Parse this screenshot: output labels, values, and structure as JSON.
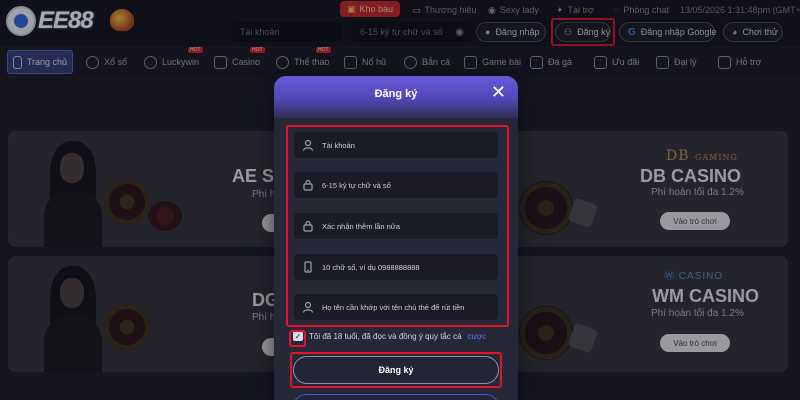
{
  "header": {
    "logo_text": "EE88",
    "links": [
      {
        "label": "Kho báu",
        "icon": "treasure-icon"
      },
      {
        "label": "Thương hiệu",
        "icon": "car-icon"
      },
      {
        "label": "Sexy lady",
        "icon": "gamepad-icon"
      },
      {
        "label": "Tài trợ",
        "icon": "sponsor-icon"
      },
      {
        "label": "Phòng chat",
        "icon": "chat-icon"
      }
    ],
    "datetime": "13/05/2026 1:31:48pm (GMT+7)",
    "account_placeholder": "Tài khoản",
    "password_placeholder": "6-15 ký tự chữ và số",
    "login_label": "Đăng nhập",
    "register_label": "Đăng ký",
    "google_login_label": "Đăng nhập Google",
    "trial_label": "Chơi thử"
  },
  "nav": {
    "items": [
      {
        "label": "Trang chủ",
        "icon": "home-icon",
        "active": true
      },
      {
        "label": "Xổ số",
        "icon": "lottery-icon"
      },
      {
        "label": "Luckywin",
        "icon": "luckywin-icon",
        "badge": "HOT"
      },
      {
        "label": "Casino",
        "icon": "casino-icon",
        "badge": "HOT"
      },
      {
        "label": "Thể thao",
        "icon": "sports-icon",
        "badge": "HOT"
      },
      {
        "label": "Nổ hũ",
        "icon": "slot-icon"
      },
      {
        "label": "Bắn cá",
        "icon": "fish-icon"
      },
      {
        "label": "Game bài",
        "icon": "cards-icon"
      },
      {
        "label": "Đá gà",
        "icon": "rooster-icon"
      },
      {
        "label": "Ưu đãi",
        "icon": "gift-icon"
      },
      {
        "label": "Đại lý",
        "icon": "agent-icon"
      },
      {
        "label": "Hỗ trợ",
        "icon": "support-icon"
      }
    ]
  },
  "cards": {
    "left_top": {
      "title": "AE SE",
      "subtitle": "Phí h"
    },
    "left_bottom": {
      "title": "DG",
      "subtitle": "Phí h"
    },
    "right_top": {
      "brand": "DB",
      "brand_sub": "GAMING",
      "title": "DB CASINO",
      "subtitle": "Phí hoàn tối đa 1.2%",
      "button": "Vào trò chơi"
    },
    "right_bottom": {
      "brand": "CASINO",
      "title": "WM CASINO",
      "subtitle": "Phí hoàn tối đa 1.2%",
      "button": "Vào trò chơi"
    }
  },
  "modal": {
    "title": "Đăng ký",
    "fields": [
      {
        "placeholder": "Tài khoản",
        "icon": "user-icon"
      },
      {
        "placeholder": "6-15 ký tự chữ và số",
        "icon": "lock-icon"
      },
      {
        "placeholder": "Xác nhận thêm lần nữa",
        "icon": "lock-icon"
      },
      {
        "placeholder": "10 chữ số, ví dụ 0988888888",
        "icon": "phone-icon"
      },
      {
        "placeholder": "Họ tên cần khớp với tên chủ thẻ để rút tiền",
        "icon": "id-user-icon"
      }
    ],
    "agree_text": "Tôi đã 18 tuổi, đã đọc và đồng ý quy tắc cá",
    "agree_link": "cược",
    "agree_checked": true,
    "submit_label": "Đăng ký"
  },
  "colors": {
    "highlight": "#e0142d",
    "accent": "#5d7dff",
    "modal_header": "#6b5ad8"
  }
}
